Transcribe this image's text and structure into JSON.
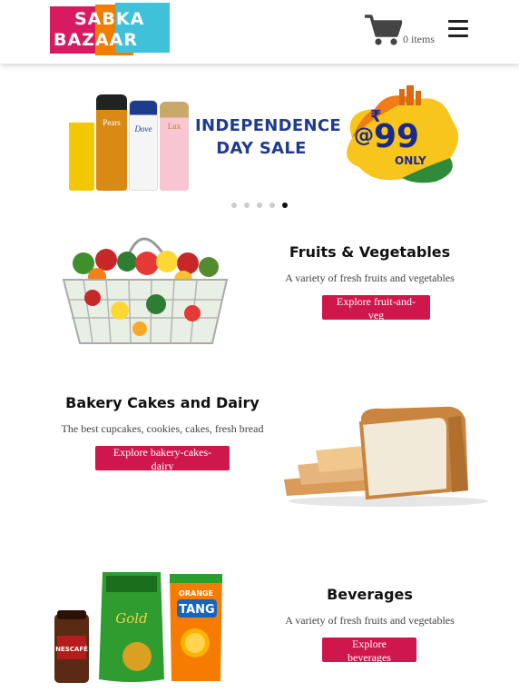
{
  "header": {
    "logo_line1": "SABKA",
    "logo_line2": "BAZAAR",
    "cart_count": "0 items"
  },
  "banner": {
    "title_line1": "INDEPENDENCE",
    "title_line2": "DAY SALE",
    "price_symbol": "@",
    "currency": "₹",
    "price": "99",
    "price_suffix": "ONLY",
    "bottle_labels": [
      "Pears",
      "Dove",
      "Lux"
    ],
    "slides": 5,
    "active_slide": 5
  },
  "categories": [
    {
      "title": "Fruits & Vegetables",
      "description": "A variety of fresh fruits and vegetables",
      "button": "Explore fruit-and-veg"
    },
    {
      "title": "Bakery Cakes and Dairy",
      "description": "The best cupcakes, cookies, cakes, fresh bread",
      "button": "Explore bakery-cakes-dairy"
    },
    {
      "title": "Beverages",
      "description": "A variety of fresh fruits and vegetables",
      "button": "Explore beverages"
    }
  ],
  "product_labels": {
    "coffee": "NESCAFÉ",
    "tea": "Gold",
    "tang_top": "ORANGE",
    "tang": "TANG"
  },
  "colors": {
    "accent": "#d0174c",
    "logo_pink": "#d81b60",
    "logo_orange": "#ef7d00",
    "logo_cyan": "#3fc1d9",
    "banner_blue": "#1f3a8f"
  }
}
